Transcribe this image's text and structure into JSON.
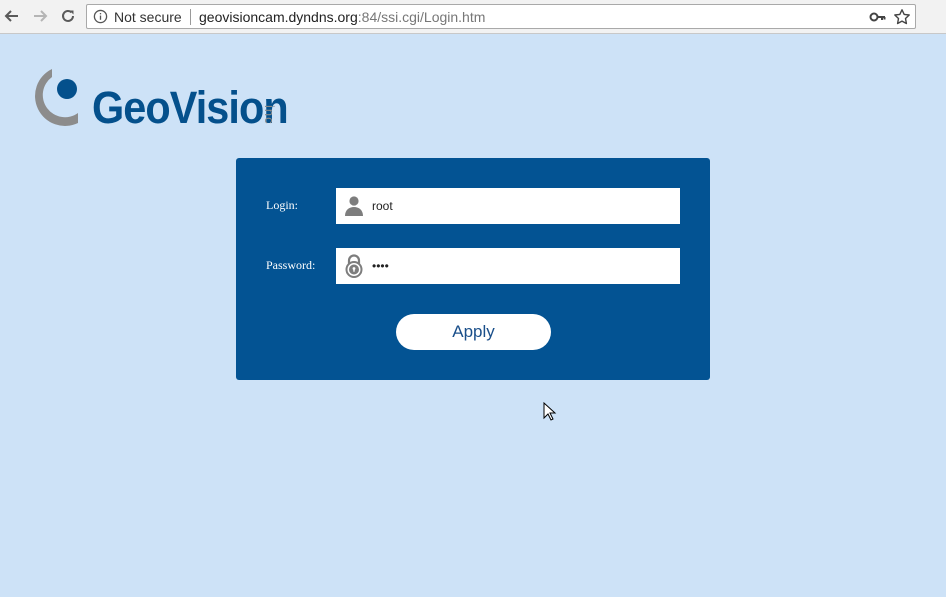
{
  "browser": {
    "security_label": "Not secure",
    "url_host": "geovisioncam.dyndns.org",
    "url_rest": ":84/ssi.cgi/Login.htm",
    "icons": [
      "back-arrow-icon",
      "forward-arrow-icon",
      "reload-icon",
      "info-icon",
      "key-icon",
      "star-icon"
    ]
  },
  "logo": {
    "name": "GeoVision",
    "suffix": "inc",
    "colors": {
      "primary": "#04508c",
      "secondary": "#8a8a8a"
    }
  },
  "login_form": {
    "login_label": "Login:",
    "login_value": "root",
    "password_label": "Password:",
    "password_value": "••••",
    "apply_label": "Apply",
    "icons": [
      "user-icon",
      "padlock-icon"
    ]
  },
  "colors": {
    "page_background": "#cde2f7",
    "panel_background": "#035393",
    "button_text": "#1a4f8a"
  }
}
